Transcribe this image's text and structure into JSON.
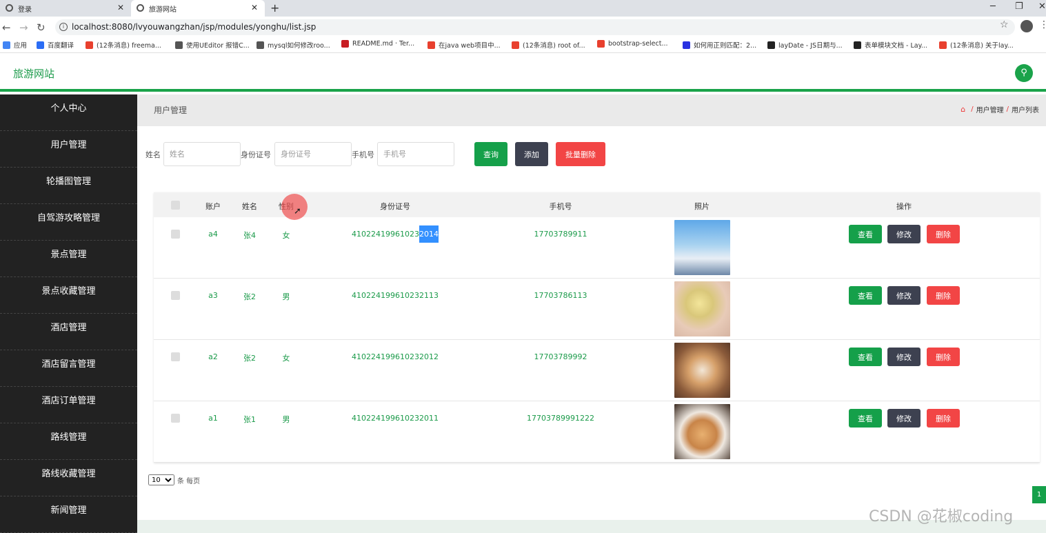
{
  "browser": {
    "tabs": [
      {
        "title": "登录"
      },
      {
        "title": "旅游网站"
      }
    ],
    "url": "localhost:8080/lvyouwangzhan/jsp/modules/yonghu/list.jsp",
    "bookmarks": [
      {
        "label": "应用",
        "color": "#4285f4"
      },
      {
        "label": "百度翻译",
        "color": "#2b6df5"
      },
      {
        "label": "(12条消息) freema...",
        "color": "#e8402e"
      },
      {
        "label": "使用UEditor 报错C...",
        "color": "#555555"
      },
      {
        "label": "mysql如何修改roo...",
        "color": "#555555"
      },
      {
        "label": "README.md · Ter...",
        "color": "#c71d23"
      },
      {
        "label": "在java web项目中...",
        "color": "#e8402e"
      },
      {
        "label": "(12条消息) root of...",
        "color": "#e8402e"
      },
      {
        "label": "bootstrap-select...",
        "color": "#e8402e"
      },
      {
        "label": "如何用正则匹配：2...",
        "color": "#2932e1"
      },
      {
        "label": "layDate - JS日期与...",
        "color": "#222222"
      },
      {
        "label": "表单模块文档 - Lay...",
        "color": "#222222"
      },
      {
        "label": "(12条消息) 关于lay...",
        "color": "#e8402e"
      }
    ]
  },
  "app": {
    "title": "旅游网站"
  },
  "sidebar": {
    "items": [
      {
        "label": "个人中心"
      },
      {
        "label": "用户管理"
      },
      {
        "label": "轮播图管理"
      },
      {
        "label": "自驾游攻略管理"
      },
      {
        "label": "景点管理"
      },
      {
        "label": "景点收藏管理"
      },
      {
        "label": "酒店管理"
      },
      {
        "label": "酒店留言管理"
      },
      {
        "label": "酒店订单管理"
      },
      {
        "label": "路线管理"
      },
      {
        "label": "路线收藏管理"
      },
      {
        "label": "新闻管理"
      }
    ]
  },
  "page": {
    "title": "用户管理",
    "breadcrumb": [
      "用户管理",
      "用户列表"
    ]
  },
  "search": {
    "name_label": "姓名",
    "name_placeholder": "姓名",
    "id_label": "身份证号",
    "id_placeholder": "身份证号",
    "phone_label": "手机号",
    "phone_placeholder": "手机号",
    "query_label": "查询",
    "add_label": "添加",
    "batch_delete_label": "批量删除"
  },
  "table": {
    "headers": [
      "账户",
      "姓名",
      "性别",
      "身份证号",
      "手机号",
      "照片",
      "操作"
    ],
    "rows": [
      {
        "account": "a4",
        "name": "张4",
        "gender": "女",
        "id_prefix": "41022419961023",
        "id_highlight": "2014",
        "phone": "17703789911",
        "photo": "anime-boy-sky-photo"
      },
      {
        "account": "a3",
        "name": "张2",
        "gender": "男",
        "id_prefix": "410224199610232113",
        "id_highlight": "",
        "phone": "17703786113",
        "photo": "anime-girl-photo"
      },
      {
        "account": "a2",
        "name": "张2",
        "gender": "女",
        "id_prefix": "410224199610232012",
        "id_highlight": "",
        "phone": "17703789992",
        "photo": "shiba-dog-photo"
      },
      {
        "account": "a1",
        "name": "张1",
        "gender": "男",
        "id_prefix": "410224199610232011",
        "id_highlight": "",
        "phone": "17703789991222",
        "photo": "cat-with-hat-photo"
      }
    ],
    "actions": {
      "view": "查看",
      "edit": "修改",
      "delete": "删除"
    }
  },
  "pager": {
    "page_size": "10",
    "page_size_options": [
      "10"
    ],
    "suffix": "条 每页",
    "current_page": "1"
  },
  "watermark": "CSDN @花椒coding",
  "colors": {
    "accent_green": "#15a04a",
    "dark_button": "#3d4150",
    "danger_red": "#f24545",
    "sidebar_bg": "#222222"
  }
}
